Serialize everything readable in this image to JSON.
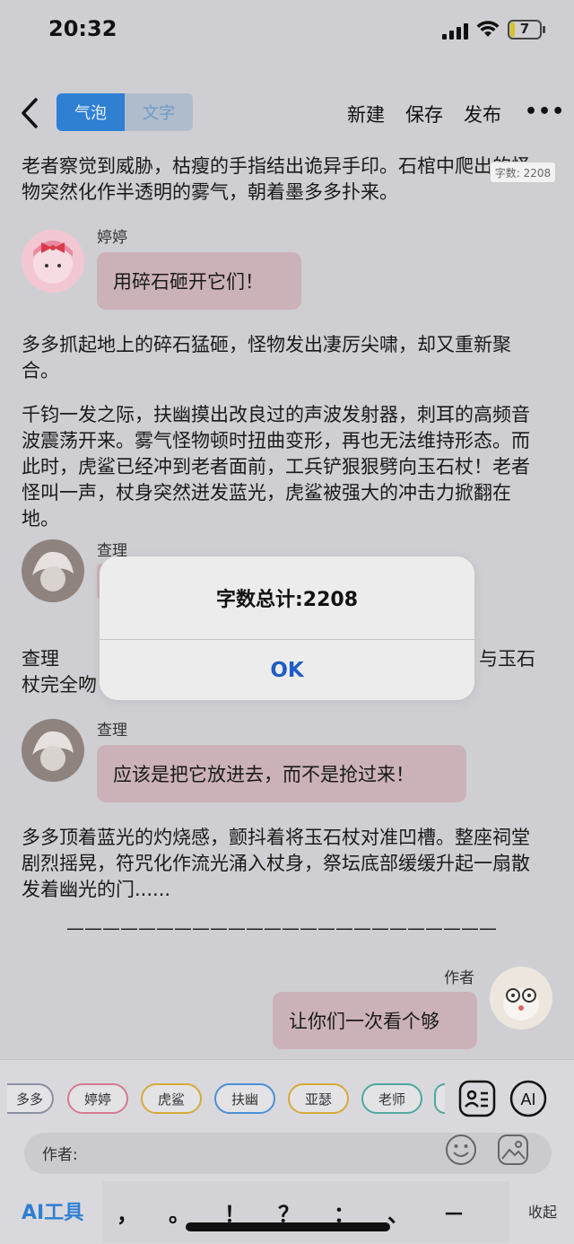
{
  "status": {
    "time": "20:32",
    "battery": "7"
  },
  "nav": {
    "seg_bubble": "气泡",
    "seg_text": "文字",
    "new": "新建",
    "save": "保存",
    "publish": "发布",
    "more": "•••"
  },
  "word_count_badge": "字数: 2208",
  "content": {
    "p1": "        老者察觉到威胁，枯瘦的手指结出诡异手印。石棺中爬出的怪物突然化作半透明的雾气，朝着墨多多扑来。",
    "m1": {
      "name": "婷婷",
      "text": "用碎石砸开它们！"
    },
    "p2": "        多多抓起地上的碎石猛砸，怪物发出凄厉尖啸，却又重新聚合。",
    "p3": "        千钧一发之际，扶幽摸出改良过的声波发射器，刺耳的高频音波震荡开来。雾气怪物顿时扭曲变形，再也无法维持形态。而此时，虎鲨已经冲到老者面前，工兵铲狠狠劈向玉石杖！老者怪叫一声，杖身突然迸发蓝光，虎鲨被强大的冲击力掀翻在地。",
    "m2": {
      "name": "查理"
    },
    "p4a": "        查理",
    "p4b": "与玉石",
    "p4c": "杖完全吻",
    "m3": {
      "name": "查理",
      "text": "应该是把它放进去，而不是抢过来！"
    },
    "p5": "        多多顶着蓝光的灼烧感，颤抖着将玉石杖对准凹槽。整座祠堂剧烈摇晃，符咒化作流光涌入杖身，祭坛底部缓缓升起一扇散发着幽光的门......",
    "divider": "————————————————————————",
    "m4": {
      "name": "作者",
      "text": "让你们一次看个够"
    }
  },
  "dialog": {
    "title": "字数总计:2208",
    "ok": "OK"
  },
  "chips": [
    {
      "label": "多多",
      "color": "#8a8fa0"
    },
    {
      "label": "婷婷",
      "color": "#d77a8e"
    },
    {
      "label": "虎鲨",
      "color": "#d6a93a"
    },
    {
      "label": "扶幽",
      "color": "#4a8fd6"
    },
    {
      "label": "亚瑟",
      "color": "#d6a93a"
    },
    {
      "label": "老师",
      "color": "#4fa6a0"
    }
  ],
  "input": {
    "author_label": "作者:"
  },
  "bottom": {
    "ai_tools": "AI工具",
    "punct": [
      "，",
      "。",
      "！",
      "？",
      "：",
      "、",
      "－"
    ],
    "collapse": "收起"
  }
}
